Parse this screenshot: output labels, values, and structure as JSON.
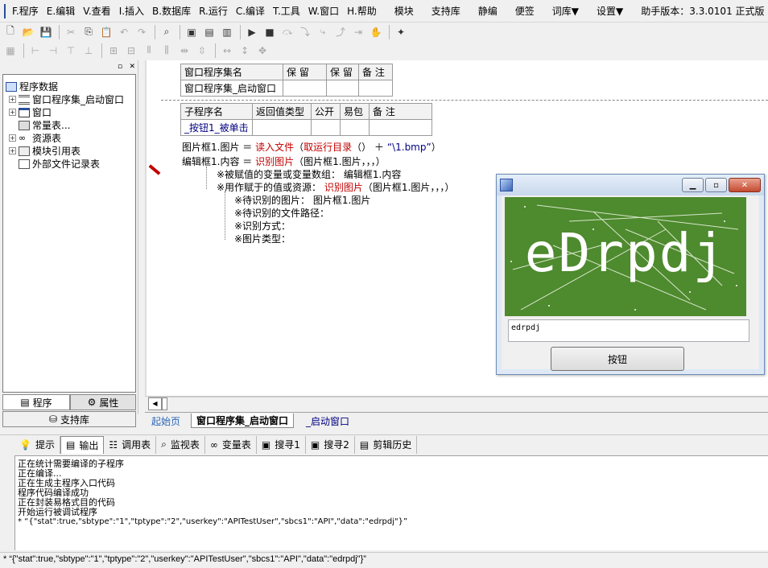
{
  "menu": {
    "items": [
      "F.程序",
      "E.编辑",
      "V.查看",
      "I.插入",
      "B.数据库",
      "R.运行",
      "C.编译",
      "T.工具",
      "W.窗口",
      "H.帮助"
    ],
    "extra": [
      "模块",
      "支持库",
      "静编",
      "便签",
      "词库▼",
      "设置▼"
    ],
    "version": "助手版本：3.3.0101 正式版"
  },
  "tree": {
    "root": "程序数据",
    "nodes": [
      "窗口程序集_启动窗口",
      "窗口",
      "常量表...",
      "资源表",
      "模块引用表",
      "外部文件记录表"
    ]
  },
  "left_tabs": {
    "program": "程序",
    "property": "属性",
    "support": "支持库"
  },
  "assembly_table": {
    "headers": [
      "窗口程序集名",
      "保 留",
      "保 留",
      "备 注"
    ],
    "row": [
      "窗口程序集_启动窗口",
      "",
      "",
      ""
    ]
  },
  "sub_table": {
    "headers": [
      "子程序名",
      "返回值类型",
      "公开",
      "易包",
      "备 注"
    ],
    "row": [
      "_按钮1_被单击",
      "",
      "",
      "",
      ""
    ]
  },
  "code": {
    "line1_target": "图片框1.图片",
    "line1_eq": "＝",
    "line1_func": "读入文件",
    "line1_args_open": "（",
    "line1_inner": "取运行目录",
    "line1_inner_args": "（）",
    "line1_plus": "＋",
    "line1_str": "“\\1.bmp”",
    "line1_close": "）",
    "line2_target": "编辑框1.内容",
    "line2_eq": "＝",
    "line2_func": "识别图片",
    "line2_args": "（图片框1.图片，，，）",
    "hint1_label": "※被赋值的变量或变量数组：",
    "hint1_value": "编辑框1.内容",
    "hint2_label": "※用作赋于的值或资源：",
    "hint2_func": "识别图片",
    "hint2_args": "（图片框1.图片，，，）",
    "param1_label": "※待识别的图片：",
    "param1_value": "图片框1.图片",
    "param2_label": "※待识别的文件路径：",
    "param3_label": "※识别方式：",
    "param4_label": "※图片类型："
  },
  "float_window": {
    "captcha_text": "eDrpdj",
    "result": "edrpdj",
    "button": "按钮"
  },
  "doc_tabs": [
    "起始页",
    "窗口程序集_启动窗口",
    "_启动窗口"
  ],
  "bottom_tabs": [
    "提示",
    "输出",
    "调用表",
    "监视表",
    "变量表",
    "搜寻1",
    "搜寻2",
    "剪辑历史"
  ],
  "output_lines": [
    "正在统计需要编译的子程序",
    "正在编译...",
    "正在生成主程序入口代码",
    "程序代码编译成功",
    "正在封装易格式目的代码",
    "开始运行被调试程序",
    "* “{\"stat\":true,\"sbtype\":\"1\",\"tptype\":\"2\",\"userkey\":\"APITestUser\",\"sbcs1\":\"API\",\"data\":\"edrpdj\"}”"
  ],
  "status_text": "*  “{\"stat\":true,\"sbtype\":\"1\",\"tptype\":\"2\",\"userkey\":\"APITestUser\",\"sbcs1\":\"API\",\"data\":\"edrpdj\"}”",
  "colors": {
    "keyword": "#c00000",
    "string": "#000080",
    "captcha_bg": "#4e8a2e"
  }
}
